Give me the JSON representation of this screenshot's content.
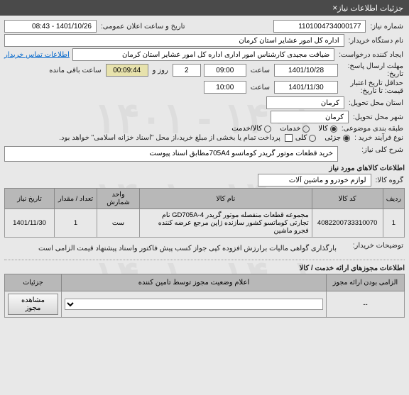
{
  "header": {
    "title": "جزئیات اطلاعات نیاز"
  },
  "fields": {
    "need_no_label": "شماره نیاز:",
    "need_no": "1101004734000177",
    "announce_label": "تاریخ و ساعت اعلان عمومی:",
    "announce_value": "1401/10/26 - 08:43",
    "buyer_label": "نام دستگاه خریدار:",
    "buyer": "اداره کل امور عشایر استان کرمان",
    "requester_label": "ایجاد کننده درخواست:",
    "requester": "ضیافت مجیدی کارشناس امور اداری اداره کل امور عشایر استان کرمان",
    "contact_link": "اطلاعات تماس خریدار",
    "deadline_label": "مهلت ارسال پاسخ:\nتاریخ:",
    "deadline_date": "1401/10/28",
    "time_label": "ساعت",
    "deadline_time": "09:00",
    "day_label": "روز و",
    "days": "2",
    "remain_time": "00:09:44",
    "remain_label": "ساعت باقی مانده",
    "validity_label": "حداقل تاریخ اعتبار\nقیمت: تا تاریخ:",
    "validity_date": "1401/11/30",
    "validity_time": "10:00",
    "loc1_label": "استان محل تحویل:",
    "loc1": "کرمان",
    "loc2_label": "شهر محل تحویل:",
    "loc2": "کرمان",
    "classify_label": "طبقه بندی موضوعی:",
    "opt_kala": "کالا",
    "opt_khadamat": "خدمات",
    "opt_kala_khadamat": "کالا/خدمت",
    "process_label": "نوع فرآیند خرید :",
    "opt_partial": "جزئی",
    "opt_full": "کلی",
    "payment_note": "پرداخت تمام یا بخشی از مبلغ خرید،از محل \"اسناد خزانه اسلامی\" خواهد بود.",
    "desc_label": "شرح کلی نیاز:",
    "desc": "خرید قطعات موتور گریدر کوماتسو 705A4مطابق اسناد پیوست",
    "items_section": "اطلاعات کالاهای مورد نیاز",
    "group_label": "گروه کالا:",
    "group": "لوازم خودرو و ماشین آلات",
    "table": {
      "h_row": "ردیف",
      "h_code": "کد کالا",
      "h_name": "نام کالا",
      "h_unit": "واحد شمارش",
      "h_qty": "تعداد / مقدار",
      "h_date": "تاریخ نیاز",
      "r1_idx": "1",
      "r1_code": "4082200733310070",
      "r1_name": "مجموعه قطعات منفصله موتور گریدر GD705A-4 نام تجارتی کوماتسو کشور سازنده ژاپن مرجع عرضه کننده فجرو ماشین",
      "r1_unit": "ست",
      "r1_qty": "1",
      "r1_date": "1401/11/30"
    },
    "buyer_note_label": "توضیحات خریدار:",
    "buyer_note": "بارگذاری گواهی مالیات برارزش افزوده کپی جواز کسب پیش فاکتور واسناد پیشنهاد قیمت الزامی است",
    "perm_section": "اطلاعات مجوزهای ارائه خدمت / کالا",
    "perm_header": "اعلام وضعیت مجوز توسط تامین کننده",
    "perm_col1": "الزامی بودن ارائه مجوز",
    "perm_col2": "جزئیات",
    "btn_view": "مشاهده مجوز"
  }
}
